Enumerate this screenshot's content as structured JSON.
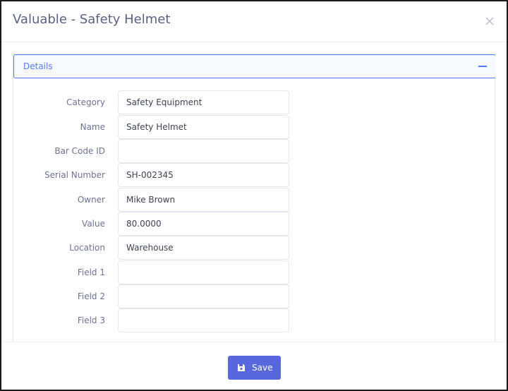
{
  "modal": {
    "title": "Valuable - Safety Helmet",
    "close_icon": "close-icon"
  },
  "panel": {
    "heading": "Details",
    "collapse_icon": "minus-icon"
  },
  "fields": [
    {
      "label": "Category",
      "value": "Safety Equipment"
    },
    {
      "label": "Name",
      "value": "Safety Helmet"
    },
    {
      "label": "Bar Code ID",
      "value": ""
    },
    {
      "label": "Serial Number",
      "value": "SH-002345"
    },
    {
      "label": "Owner",
      "value": "Mike Brown"
    },
    {
      "label": "Value",
      "value": "80.0000"
    },
    {
      "label": "Location",
      "value": "Warehouse"
    },
    {
      "label": "Field 1",
      "value": ""
    },
    {
      "label": "Field 2",
      "value": ""
    },
    {
      "label": "Field 3",
      "value": ""
    }
  ],
  "footer": {
    "save_label": "Save",
    "save_icon": "floppy-disk-icon"
  },
  "colors": {
    "primary": "#5867dd",
    "accent_blue": "#4f7df9",
    "title_text": "#5a6080",
    "label_text": "#6c7290"
  }
}
